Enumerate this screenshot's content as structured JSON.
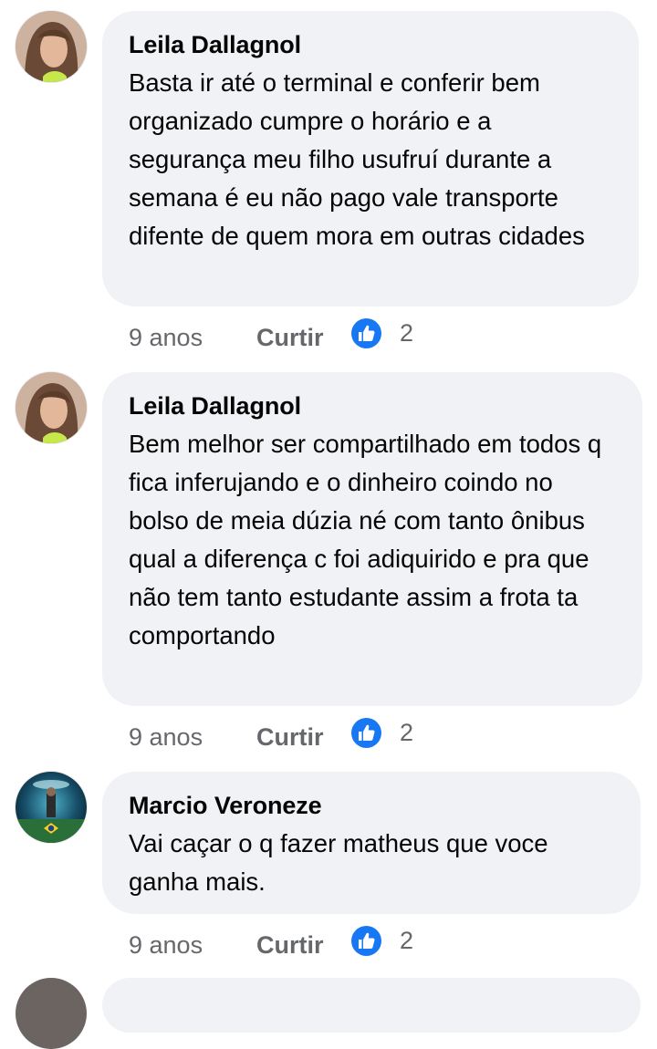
{
  "comments": [
    {
      "author": "Leila Dallagnol",
      "text": "Basta ir até o terminal e conferir  bem organizado cumpre o horário e a segurança  meu filho usufruí durante a semana é eu não pago vale transporte difente de quem mora em outras cidades",
      "time": "9 anos",
      "like_label": "Curtir",
      "reaction_icon": "like-icon",
      "reaction_count": "2"
    },
    {
      "author": "Leila Dallagnol",
      "text": "Bem melhor ser compartilhado em todos q fica inferujando e o dinheiro coindo no bolso de meia dúzia né com tanto ônibus qual a diferença c foi adiquirido e pra que não tem tanto estudante assim a frota ta comportando",
      "time": "9 anos",
      "like_label": "Curtir",
      "reaction_icon": "like-icon",
      "reaction_count": "2"
    },
    {
      "author": "Marcio Veroneze",
      "text": "Vai caçar o q fazer matheus que voce ganha mais.",
      "time": "9 anos",
      "like_label": "Curtir",
      "reaction_icon": "like-icon",
      "reaction_count": "2"
    }
  ],
  "colors": {
    "bubble": "#f0f2f5",
    "meta_text": "#65676b",
    "like_blue": "#1877f2"
  }
}
